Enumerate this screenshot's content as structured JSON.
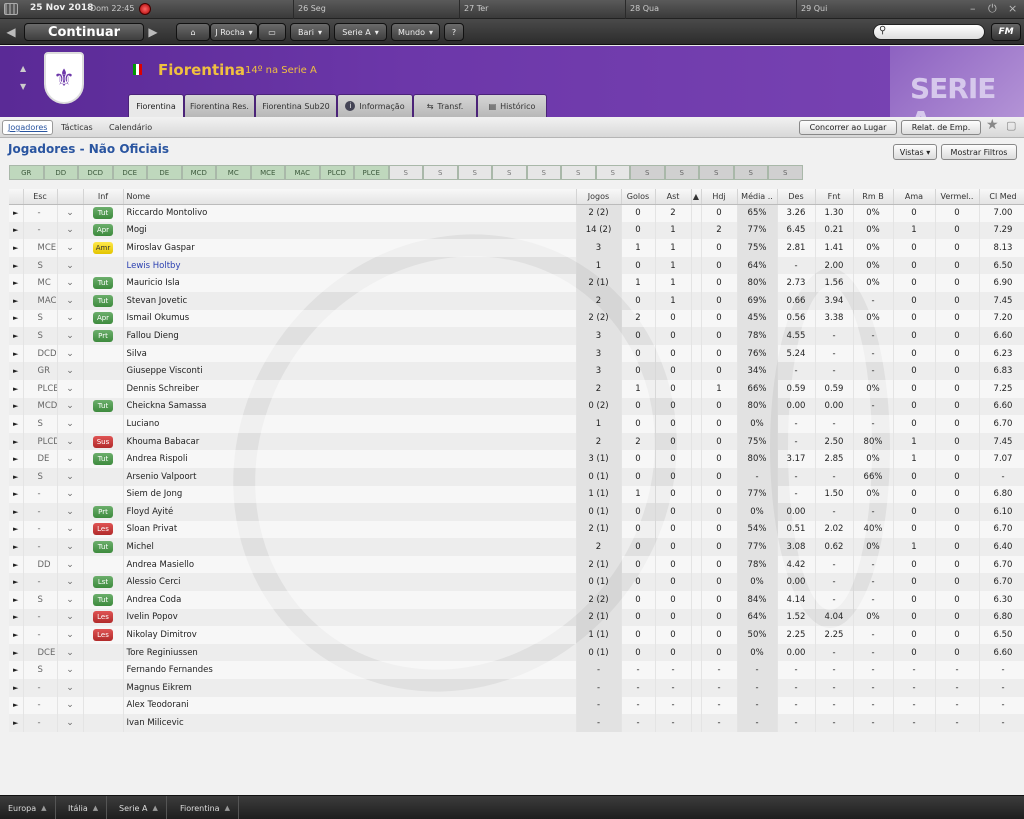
{
  "topbar": {
    "date": "25 Nov 2018",
    "time": "Dom 22:45",
    "days": [
      "26 Seg",
      "27 Ter",
      "28 Qua",
      "29 Qui"
    ]
  },
  "nav": {
    "continue": "Continuar",
    "manager": "J Rocha",
    "club_menu": "Bari",
    "league_menu": "Serie A",
    "world_menu": "Mundo",
    "help": "?",
    "fm": "FM"
  },
  "header": {
    "club": "Fiorentina",
    "position": "14º na Serie A",
    "crest": "⚜",
    "badge_text": "SERIE A",
    "tabs": [
      "Fiorentina",
      "Fiorentina Res.",
      "Fiorentina Sub20",
      "Informação",
      "Transf.",
      "Histórico"
    ]
  },
  "subnav": {
    "tabs": [
      "Jogadores",
      "Tácticas",
      "Calendário"
    ],
    "actions": [
      "Concorrer ao Lugar",
      "Relat. de Emp."
    ]
  },
  "panel": {
    "title": "Jogadores - Não Oficiais",
    "views_btn": "Vistas",
    "filters_btn": "Mostrar Filtros",
    "positions": [
      "GR",
      "DD",
      "DCD",
      "DCE",
      "DE",
      "MCD",
      "MC",
      "MCE",
      "MAC",
      "PLCD",
      "PLCE",
      "S",
      "S",
      "S",
      "S",
      "S",
      "S",
      "S",
      "S",
      "S",
      "S",
      "S",
      "S"
    ]
  },
  "columns": [
    "Esc",
    "Inf",
    "Nome",
    "Jogos",
    "Golos",
    "Ast",
    "",
    "Hdj",
    "Média ..",
    "Des",
    "Fnt",
    "Rm B",
    "Ama",
    "Vermel..",
    "Cl Med"
  ],
  "players": [
    [
      "-",
      "Tut",
      "Riccardo Montolivo",
      "2 (2)",
      "0",
      "2",
      "",
      "0",
      "65%",
      "3.26",
      "1.30",
      "0%",
      "0",
      "0",
      "7.00"
    ],
    [
      "-",
      "Apr",
      "Mogi",
      "14 (2)",
      "0",
      "1",
      "",
      "2",
      "77%",
      "6.45",
      "0.21",
      "0%",
      "1",
      "0",
      "7.29"
    ],
    [
      "MCE",
      "Amr",
      "Miroslav Gaspar",
      "3",
      "1",
      "1",
      "",
      "0",
      "75%",
      "2.81",
      "1.41",
      "0%",
      "0",
      "0",
      "8.13"
    ],
    [
      "S",
      "",
      "Lewis Holtby",
      "1",
      "0",
      "1",
      "",
      "0",
      "64%",
      "-",
      "2.00",
      "0%",
      "0",
      "0",
      "6.50"
    ],
    [
      "MC",
      "Tut",
      "Mauricio Isla",
      "2 (1)",
      "1",
      "1",
      "",
      "0",
      "80%",
      "2.73",
      "1.56",
      "0%",
      "0",
      "0",
      "6.90"
    ],
    [
      "MAC",
      "Tut",
      "Stevan Jovetic",
      "2",
      "0",
      "1",
      "",
      "0",
      "69%",
      "0.66",
      "3.94",
      "-",
      "0",
      "0",
      "7.45"
    ],
    [
      "S",
      "Apr",
      "Ismail Okumus",
      "2 (2)",
      "2",
      "0",
      "",
      "0",
      "45%",
      "0.56",
      "3.38",
      "0%",
      "0",
      "0",
      "7.20"
    ],
    [
      "S",
      "Prt",
      "Fallou Dieng",
      "3",
      "0",
      "0",
      "",
      "0",
      "78%",
      "4.55",
      "-",
      "-",
      "0",
      "0",
      "6.60"
    ],
    [
      "DCD",
      "",
      "Silva",
      "3",
      "0",
      "0",
      "",
      "0",
      "76%",
      "5.24",
      "-",
      "-",
      "0",
      "0",
      "6.23"
    ],
    [
      "GR",
      "",
      "Giuseppe Visconti",
      "3",
      "0",
      "0",
      "",
      "0",
      "34%",
      "-",
      "-",
      "-",
      "0",
      "0",
      "6.83"
    ],
    [
      "PLCE",
      "",
      "Dennis Schreiber",
      "2",
      "1",
      "0",
      "",
      "1",
      "66%",
      "0.59",
      "0.59",
      "0%",
      "0",
      "0",
      "7.25"
    ],
    [
      "MCD",
      "Tut",
      "Cheickna Samassa",
      "0 (2)",
      "0",
      "0",
      "",
      "0",
      "80%",
      "0.00",
      "0.00",
      "-",
      "0",
      "0",
      "6.60"
    ],
    [
      "S",
      "",
      "Luciano",
      "1",
      "0",
      "0",
      "",
      "0",
      "0%",
      "-",
      "-",
      "-",
      "0",
      "0",
      "6.70"
    ],
    [
      "PLCD",
      "Sus",
      "Khouma Babacar",
      "2",
      "2",
      "0",
      "",
      "0",
      "75%",
      "-",
      "2.50",
      "80%",
      "1",
      "0",
      "7.45"
    ],
    [
      "DE",
      "Tut",
      "Andrea Rispoli",
      "3 (1)",
      "0",
      "0",
      "",
      "0",
      "80%",
      "3.17",
      "2.85",
      "0%",
      "1",
      "0",
      "7.07"
    ],
    [
      "S",
      "",
      "Arsenio Valpoort",
      "0 (1)",
      "0",
      "0",
      "",
      "0",
      "-",
      "-",
      "-",
      "66%",
      "0",
      "0",
      "-"
    ],
    [
      "-",
      "",
      "Siem de Jong",
      "1 (1)",
      "1",
      "0",
      "",
      "0",
      "77%",
      "-",
      "1.50",
      "0%",
      "0",
      "0",
      "6.80"
    ],
    [
      "-",
      "Prt",
      "Floyd Ayité",
      "0 (1)",
      "0",
      "0",
      "",
      "0",
      "0%",
      "0.00",
      "-",
      "-",
      "0",
      "0",
      "6.10"
    ],
    [
      "-",
      "Les",
      "Sloan Privat",
      "2 (1)",
      "0",
      "0",
      "",
      "0",
      "54%",
      "0.51",
      "2.02",
      "40%",
      "0",
      "0",
      "6.70"
    ],
    [
      "-",
      "Tut",
      "Michel",
      "2",
      "0",
      "0",
      "",
      "0",
      "77%",
      "3.08",
      "0.62",
      "0%",
      "1",
      "0",
      "6.40"
    ],
    [
      "DD",
      "",
      "Andrea Masiello",
      "2 (1)",
      "0",
      "0",
      "",
      "0",
      "78%",
      "4.42",
      "-",
      "-",
      "0",
      "0",
      "6.70"
    ],
    [
      "-",
      "Lst",
      "Alessio Cerci",
      "0 (1)",
      "0",
      "0",
      "",
      "0",
      "0%",
      "0.00",
      "-",
      "-",
      "0",
      "0",
      "6.70"
    ],
    [
      "S",
      "Tut",
      "Andrea Coda",
      "2 (2)",
      "0",
      "0",
      "",
      "0",
      "84%",
      "4.14",
      "-",
      "-",
      "0",
      "0",
      "6.30"
    ],
    [
      "-",
      "Les",
      "Ivelin Popov",
      "2 (1)",
      "0",
      "0",
      "",
      "0",
      "64%",
      "1.52",
      "4.04",
      "0%",
      "0",
      "0",
      "6.80"
    ],
    [
      "-",
      "Les",
      "Nikolay Dimitrov",
      "1 (1)",
      "0",
      "0",
      "",
      "0",
      "50%",
      "2.25",
      "2.25",
      "-",
      "0",
      "0",
      "6.50"
    ],
    [
      "DCE",
      "",
      "Tore Reginiussen",
      "0 (1)",
      "0",
      "0",
      "",
      "0",
      "0%",
      "0.00",
      "-",
      "-",
      "0",
      "0",
      "6.60"
    ],
    [
      "S",
      "",
      "Fernando Fernandes",
      "-",
      "-",
      "-",
      "",
      "-",
      "-",
      "-",
      "-",
      "-",
      "-",
      "-",
      "-"
    ],
    [
      "-",
      "",
      "Magnus Eikrem",
      "-",
      "-",
      "-",
      "",
      "-",
      "-",
      "-",
      "-",
      "-",
      "-",
      "-",
      "-"
    ],
    [
      "-",
      "",
      "Alex Teodorani",
      "-",
      "-",
      "-",
      "",
      "-",
      "-",
      "-",
      "-",
      "-",
      "-",
      "-",
      "-"
    ],
    [
      "-",
      "",
      "Ivan Milicevic",
      "-",
      "-",
      "-",
      "",
      "-",
      "-",
      "-",
      "-",
      "-",
      "-",
      "-",
      "-"
    ]
  ],
  "footer": {
    "crumbs": [
      "Europa",
      "Itália",
      "Serie A",
      "Fiorentina"
    ]
  },
  "colors": {
    "accent": "#2a55a0",
    "header_purple": "#6c37a9",
    "club_gold": "#f0c040",
    "badge_green": "#4d9a4d",
    "badge_red": "#c23636",
    "badge_yellow": "#f2d900"
  }
}
